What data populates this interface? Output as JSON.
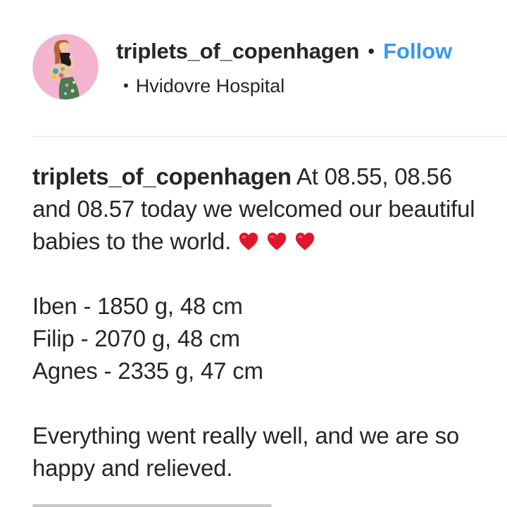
{
  "post_header": {
    "username": "triplets_of_copenhagen",
    "separator": "•",
    "follow_label": "Follow",
    "location_bullet": "•",
    "location": "Hvidovre Hospital",
    "avatar_icon": "profile-photo-avatar"
  },
  "caption": {
    "username": "triplets_of_copenhagen",
    "intro": "At 08.55, 08.56 and 08.57 today we welcomed our beautiful babies to the world.",
    "emoji_icons": [
      "red-heart-icon",
      "red-heart-icon",
      "red-heart-icon"
    ],
    "babies": [
      "Iben - 1850 g, 48 cm",
      "Filip - 2070 g, 48 cm",
      "Agnes - 2335 g, 47 cm"
    ],
    "closing": "Everything went really well, and we are so happy and relieved."
  },
  "colors": {
    "follow_blue": "#3897f0",
    "text": "#262626",
    "heart_red": "#e0162b",
    "divider": "#efefef"
  }
}
